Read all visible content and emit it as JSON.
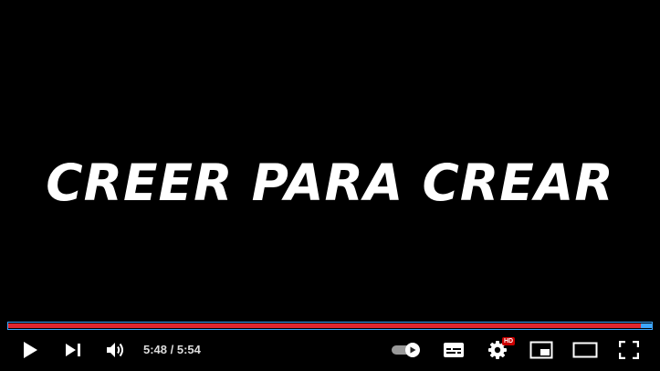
{
  "video": {
    "overlay_text": "CREER PARA CREAR"
  },
  "player": {
    "current_time": "5:48",
    "duration": "5:54",
    "time_separator": " / ",
    "progress_fraction": 0.982,
    "hd_badge": "HD",
    "colors": {
      "played": "#e0262e",
      "buffered": "#3ea6ff",
      "icon": "#ffffff"
    },
    "icons": [
      "play-icon",
      "next-icon",
      "volume-icon",
      "autoplay-toggle-icon",
      "subtitles-icon",
      "settings-icon",
      "miniplayer-icon",
      "theater-icon",
      "fullscreen-icon"
    ]
  }
}
